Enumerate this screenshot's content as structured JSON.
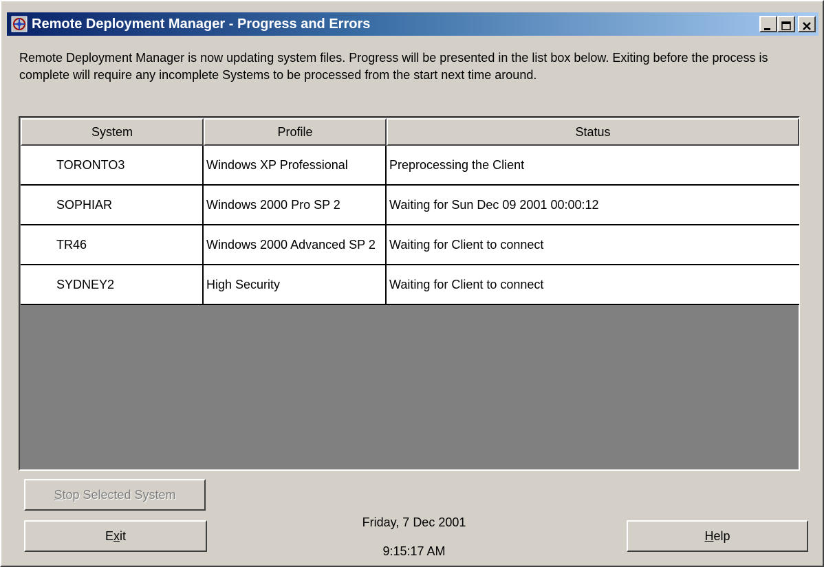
{
  "window": {
    "title": "Remote Deployment Manager - Progress and Errors",
    "title_bar_color": "#0a246a"
  },
  "description": "Remote Deployment Manager is now updating system files.  Progress will be presented in the list box below.  Exiting before the process is complete will require any incomplete Systems to be processed from the start next time around.",
  "list": {
    "columns": {
      "system": "System",
      "profile": "Profile",
      "status": "Status"
    },
    "rows": [
      {
        "system": "TORONTO3",
        "profile": "Windows XP Professional",
        "status": "Preprocessing the Client"
      },
      {
        "system": "SOPHIAR",
        "profile": "Windows 2000 Pro SP 2",
        "status": "Waiting for  Sun Dec 09 2001 00:00:12"
      },
      {
        "system": "TR46",
        "profile": "Windows 2000 Advanced SP 2",
        "status": "Waiting for Client to connect"
      },
      {
        "system": "SYDNEY2",
        "profile": "High Security",
        "status": "Waiting for Client to connect"
      }
    ]
  },
  "buttons": {
    "stop_selected": {
      "accel": "S",
      "rest": "top Selected System"
    },
    "exit": {
      "pre": "E",
      "accel": "x",
      "rest": "it"
    },
    "help": {
      "accel": "H",
      "rest": "elp"
    }
  },
  "clock": {
    "date": "Friday, 7 Dec 2001",
    "time": "9:15:17 AM"
  }
}
